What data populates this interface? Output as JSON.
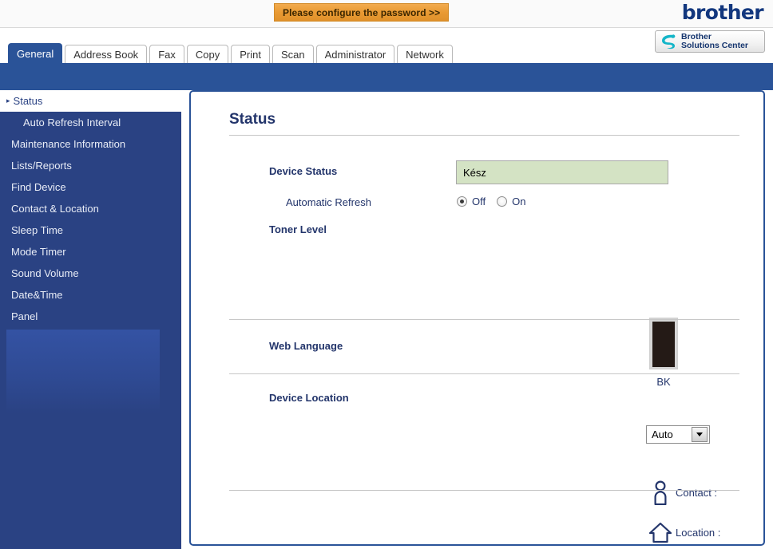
{
  "header": {
    "password_banner": "Please configure the password >>",
    "brand_logo": "brother",
    "solutions_center": {
      "line1": "Brother",
      "line2": "Solutions Center",
      "icon": "brother-swoosh-icon"
    }
  },
  "tabs": [
    {
      "label": "General",
      "active": true
    },
    {
      "label": "Address Book",
      "active": false
    },
    {
      "label": "Fax",
      "active": false
    },
    {
      "label": "Copy",
      "active": false
    },
    {
      "label": "Print",
      "active": false
    },
    {
      "label": "Scan",
      "active": false
    },
    {
      "label": "Administrator",
      "active": false
    },
    {
      "label": "Network",
      "active": false
    }
  ],
  "sidebar": {
    "items": [
      {
        "label": "Status",
        "active": true,
        "sub": false
      },
      {
        "label": "Auto Refresh Interval",
        "active": false,
        "sub": true
      },
      {
        "label": "Maintenance Information",
        "active": false,
        "sub": false
      },
      {
        "label": "Lists/Reports",
        "active": false,
        "sub": false
      },
      {
        "label": "Find Device",
        "active": false,
        "sub": false
      },
      {
        "label": "Contact & Location",
        "active": false,
        "sub": false
      },
      {
        "label": "Sleep Time",
        "active": false,
        "sub": false
      },
      {
        "label": "Mode Timer",
        "active": false,
        "sub": false
      },
      {
        "label": "Sound Volume",
        "active": false,
        "sub": false
      },
      {
        "label": "Date&Time",
        "active": false,
        "sub": false
      },
      {
        "label": "Panel",
        "active": false,
        "sub": false
      }
    ]
  },
  "main": {
    "title": "Status",
    "device_status": {
      "label": "Device Status",
      "value": "Kész"
    },
    "automatic_refresh": {
      "label": "Automatic Refresh",
      "options": [
        {
          "label": "Off",
          "selected": true
        },
        {
          "label": "On",
          "selected": false
        }
      ]
    },
    "toner_level": {
      "label": "Toner Level",
      "cartridges": [
        {
          "name": "BK",
          "fill_percent": 97,
          "color": "#241a16"
        }
      ]
    },
    "web_language": {
      "label": "Web Language",
      "value": "Auto"
    },
    "device_location": {
      "label": "Device Location",
      "contact": {
        "icon": "person-icon",
        "label": "Contact :",
        "value": ""
      },
      "location": {
        "icon": "house-icon",
        "label": "Location :",
        "value": ""
      }
    }
  },
  "colors": {
    "brand_blue": "#2a5398",
    "sidebar_blue": "#2a4283",
    "status_green": "#d4e3c4",
    "banner_orange": "#e99a33",
    "text_navy": "#23356b"
  }
}
